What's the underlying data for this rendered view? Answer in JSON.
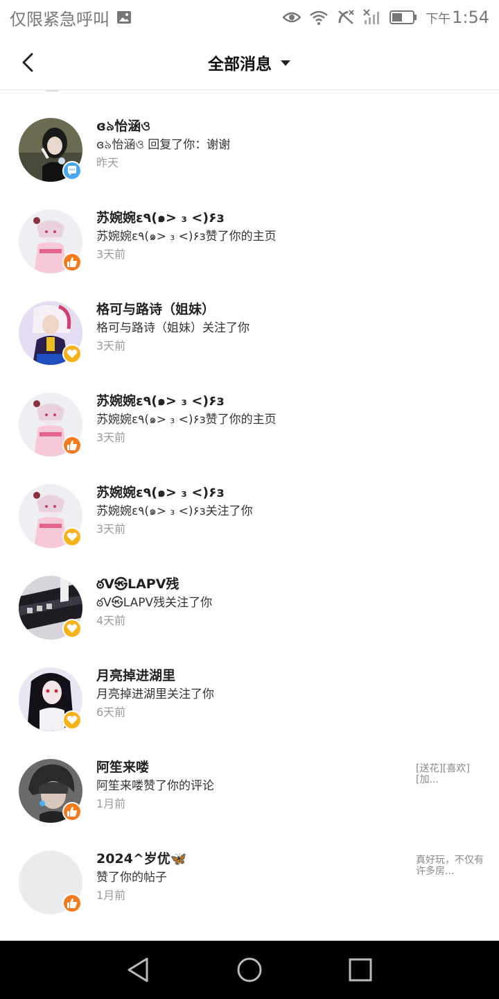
{
  "status_bar": {
    "carrier_text": "仅限紧急呼叫",
    "time_prefix": "下午",
    "time": "1:54",
    "icons": [
      "image-icon",
      "eye-icon",
      "wifi-icon",
      "no-call-icon",
      "no-signal-icon",
      "battery-icon"
    ]
  },
  "header": {
    "title": "全部消息",
    "back_icon": "chevron-left-icon",
    "dropdown_icon": "triangle-down-icon"
  },
  "colors": {
    "like_badge": "#f47a1f",
    "follow_badge": "#f5b21b",
    "comment_badge": "#4aa8ef",
    "nav_bar": "#000000"
  },
  "messages": [
    {
      "name": "ɞ৯怡涵ও",
      "text": "ɞ৯怡涵ও 回复了你：谢谢",
      "time": "昨天",
      "badge": "comment",
      "preview": ""
    },
    {
      "name": "苏婉婉ε٩(๑> ₃ <)۶з",
      "text": "苏婉婉ε٩(๑> ₃ <)۶з赞了你的主页",
      "time": "3天前",
      "badge": "like",
      "preview": ""
    },
    {
      "name": "格可与路诗（姐妹）",
      "text": "格可与路诗（姐妹）关注了你",
      "time": "3天前",
      "badge": "follow",
      "preview": ""
    },
    {
      "name": "苏婉婉ε٩(๑> ₃ <)۶з",
      "text": "苏婉婉ε٩(๑> ₃ <)۶з赞了你的主页",
      "time": "3天前",
      "badge": "like",
      "preview": ""
    },
    {
      "name": "苏婉婉ε٩(๑> ₃ <)۶з",
      "text": "苏婉婉ε٩(๑> ₃ <)۶з关注了你",
      "time": "3天前",
      "badge": "follow",
      "preview": ""
    },
    {
      "name": "ఠV㉿LAPV残",
      "text": "ఠV㉿LAPV残关注了你",
      "time": "4天前",
      "badge": "follow",
      "preview": ""
    },
    {
      "name": "月亮掉进湖里",
      "text": "月亮掉进湖里关注了你",
      "time": "6天前",
      "badge": "follow",
      "preview": ""
    },
    {
      "name": "阿笙来喽",
      "text": "阿笙来喽赞了你的评论",
      "time": "1月前",
      "badge": "like",
      "preview": "[送花][喜欢][加..."
    },
    {
      "name": "2024^岁优🦋",
      "text": "赞了你的帖子",
      "time": "1月前",
      "badge": "like",
      "preview": "真好玩，不仅有许多房..."
    }
  ],
  "nav_bar": {
    "icons": [
      "back-triangle-icon",
      "home-circle-icon",
      "recents-square-icon"
    ]
  }
}
